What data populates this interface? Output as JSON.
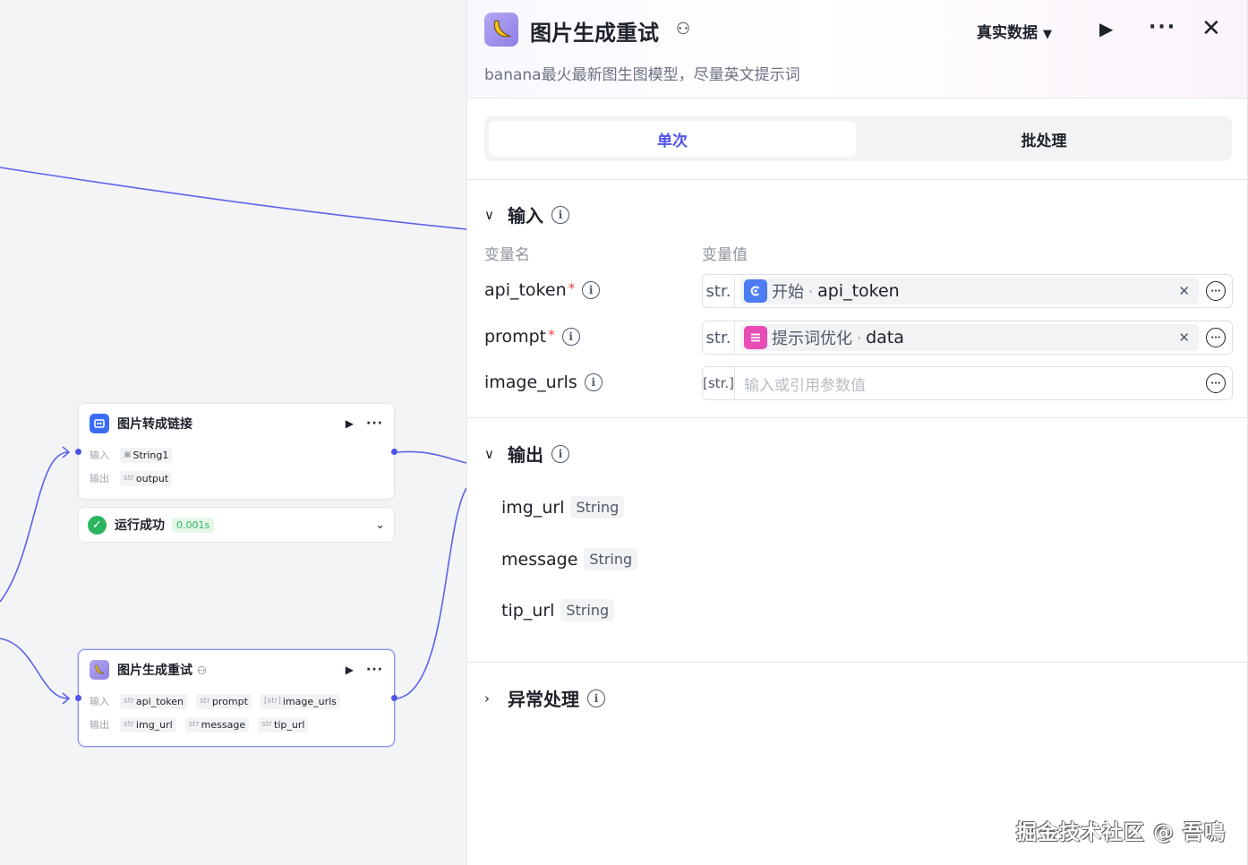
{
  "canvas": {
    "node_image_to_link": {
      "title": "图片转成链接",
      "input_label": "输入",
      "output_label": "输出",
      "inputs": [
        {
          "type": "img",
          "name": "String1"
        }
      ],
      "outputs": [
        {
          "type": "str",
          "name": "output"
        }
      ],
      "status": {
        "text": "运行成功",
        "time": "0.001s"
      }
    },
    "node_image_retry": {
      "title": "图片生成重试",
      "input_label": "输入",
      "output_label": "输出",
      "inputs": [
        {
          "type": "str",
          "name": "api_token"
        },
        {
          "type": "str",
          "name": "prompt"
        },
        {
          "type": "[str]",
          "name": "image_urls"
        }
      ],
      "outputs": [
        {
          "type": "str",
          "name": "img_url"
        },
        {
          "type": "str",
          "name": "message"
        },
        {
          "type": "str",
          "name": "tip_url"
        }
      ]
    }
  },
  "panel": {
    "title": "图片生成重试",
    "description": "banana最火最新图生图模型，尽量英文提示词",
    "data_mode": "真实数据",
    "tabs": [
      {
        "label": "单次",
        "active": true
      },
      {
        "label": "批处理",
        "active": false
      }
    ],
    "input_section": {
      "title": "输入",
      "col_name": "变量名",
      "col_value": "变量值",
      "rows": [
        {
          "name": "api_token",
          "required": "*",
          "type": "str.",
          "ref_node": "开始",
          "ref_var": "api_token",
          "ref_color": "#4d7cf3"
        },
        {
          "name": "prompt",
          "required": "*",
          "type": "str.",
          "ref_node": "提示词优化",
          "ref_var": "data",
          "ref_color": "#e84cb5"
        },
        {
          "name": "image_urls",
          "required": "",
          "type": "[str.]",
          "placeholder": "输入或引用参数值"
        }
      ]
    },
    "output_section": {
      "title": "输出",
      "rows": [
        {
          "name": "img_url",
          "type": "String"
        },
        {
          "name": "message",
          "type": "String"
        },
        {
          "name": "tip_url",
          "type": "String"
        }
      ]
    },
    "exception_section": {
      "title": "异常处理"
    }
  },
  "watermark": "掘金技术社区 @ 吾鳴"
}
